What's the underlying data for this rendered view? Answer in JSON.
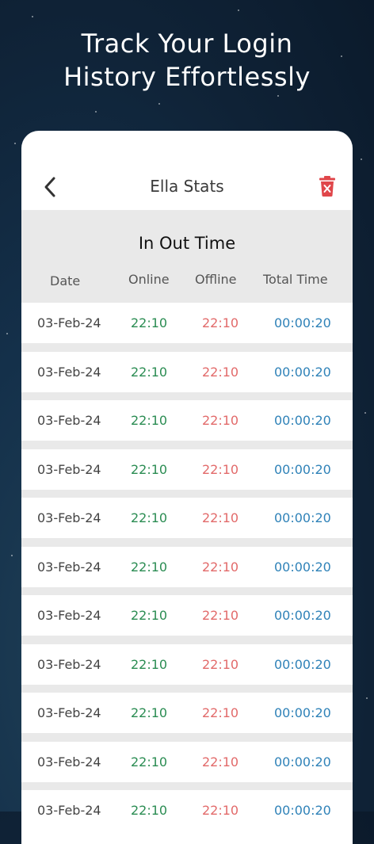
{
  "promo": {
    "line1": "Track Your Login",
    "line2": "History Effortlessly"
  },
  "header": {
    "title": "Ella Stats",
    "back_icon": "chevron-left-icon",
    "delete_icon": "trash-x-icon"
  },
  "table": {
    "title": "In Out Time",
    "columns": {
      "date": "Date",
      "online": "Online",
      "offline": "Offline",
      "total": "Total Time"
    },
    "rows": [
      {
        "date": "03-Feb-24",
        "online": "22:10",
        "offline": "22:10",
        "total": "00:00:20"
      },
      {
        "date": "03-Feb-24",
        "online": "22:10",
        "offline": "22:10",
        "total": "00:00:20"
      },
      {
        "date": "03-Feb-24",
        "online": "22:10",
        "offline": "22:10",
        "total": "00:00:20"
      },
      {
        "date": "03-Feb-24",
        "online": "22:10",
        "offline": "22:10",
        "total": "00:00:20"
      },
      {
        "date": "03-Feb-24",
        "online": "22:10",
        "offline": "22:10",
        "total": "00:00:20"
      },
      {
        "date": "03-Feb-24",
        "online": "22:10",
        "offline": "22:10",
        "total": "00:00:20"
      },
      {
        "date": "03-Feb-24",
        "online": "22:10",
        "offline": "22:10",
        "total": "00:00:20"
      },
      {
        "date": "03-Feb-24",
        "online": "22:10",
        "offline": "22:10",
        "total": "00:00:20"
      },
      {
        "date": "03-Feb-24",
        "online": "22:10",
        "offline": "22:10",
        "total": "00:00:20"
      },
      {
        "date": "03-Feb-24",
        "online": "22:10",
        "offline": "22:10",
        "total": "00:00:20"
      },
      {
        "date": "03-Feb-24",
        "online": "22:10",
        "offline": "22:10",
        "total": "00:00:20"
      }
    ]
  },
  "colors": {
    "online": "#2a8c52",
    "offline": "#e26a6a",
    "total": "#2f82b8",
    "delete": "#e0464a"
  }
}
